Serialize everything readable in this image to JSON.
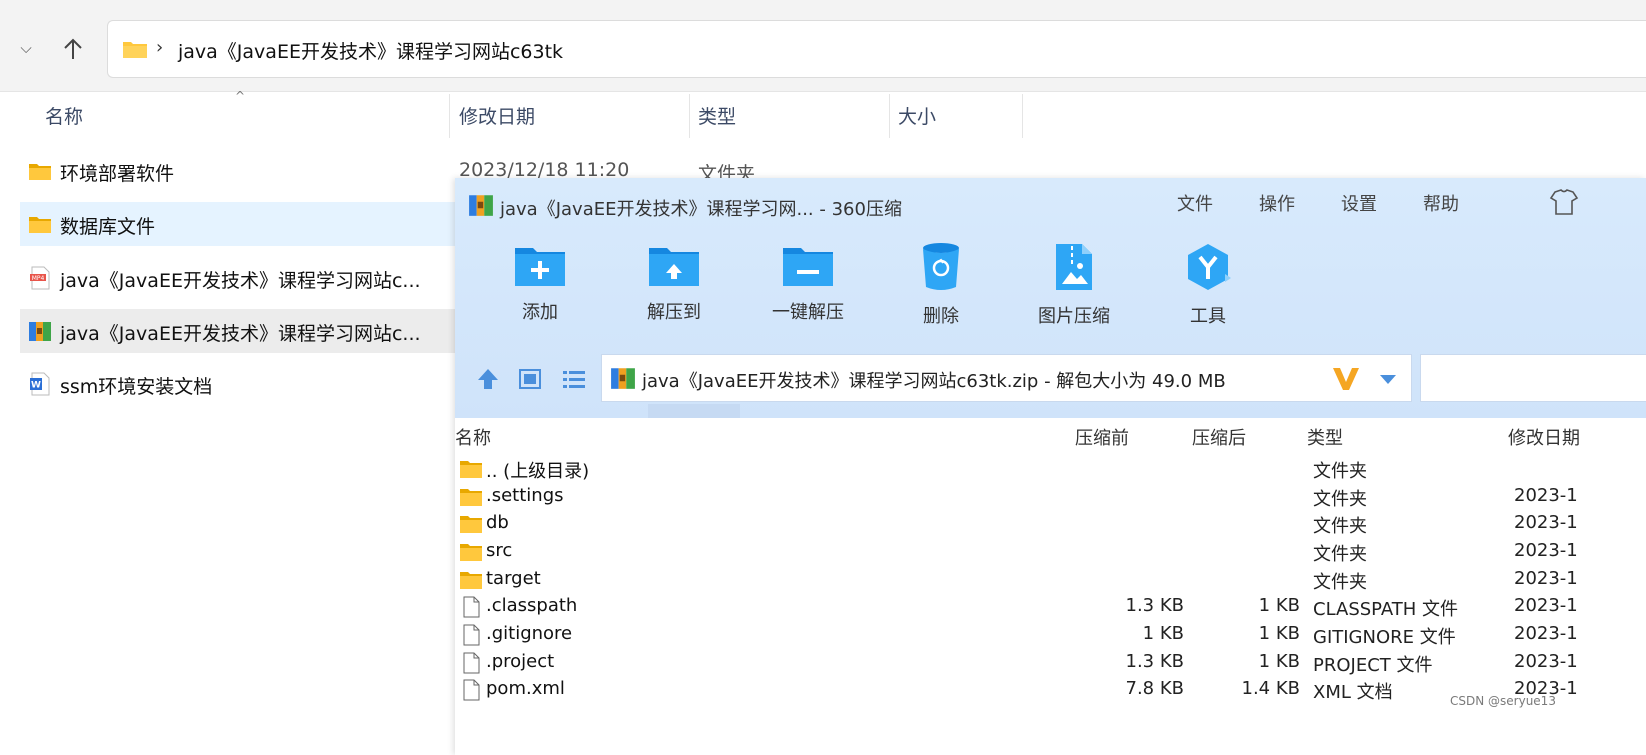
{
  "explorer": {
    "address_path": "java《JavaEE开发技术》课程学习网站c63tk",
    "breadcrumb_sep": "›",
    "columns": {
      "name": "名称",
      "modified": "修改日期",
      "type": "类型",
      "size": "大小"
    },
    "files": [
      {
        "name": "环境部署软件",
        "icon": "folder-icon",
        "modified": "2023/12/18 11:20",
        "type": "文件夹"
      },
      {
        "name": "数据库文件",
        "icon": "folder-icon"
      },
      {
        "name": "java《JavaEE开发技术》课程学习网站c...",
        "icon": "mp4-file-icon"
      },
      {
        "name": "java《JavaEE开发技术》课程学习网站c...",
        "icon": "zip-archive-icon"
      },
      {
        "name": "ssm环境安装文档",
        "icon": "word-document-icon"
      }
    ]
  },
  "zip": {
    "title": "java《JavaEE开发技术》课程学习网... - 360压缩",
    "menu": [
      "文件",
      "操作",
      "设置",
      "帮助"
    ],
    "tools": [
      "添加",
      "解压到",
      "一键解压",
      "删除",
      "图片压缩",
      "工具"
    ],
    "path_text": "java《JavaEE开发技术》课程学习网站c63tk.zip - 解包大小为 49.0 MB",
    "columns": {
      "name": "名称",
      "before": "压缩前",
      "after": "压缩后",
      "type": "类型",
      "modified": "修改日期"
    },
    "rows": [
      {
        "name": ".. (上级目录)",
        "icon": "folder-icon",
        "before": "",
        "after": "",
        "type": "文件夹",
        "modified": ""
      },
      {
        "name": ".settings",
        "icon": "folder-icon",
        "before": "",
        "after": "",
        "type": "文件夹",
        "modified": "2023-1"
      },
      {
        "name": "db",
        "icon": "folder-icon",
        "before": "",
        "after": "",
        "type": "文件夹",
        "modified": "2023-1"
      },
      {
        "name": "src",
        "icon": "folder-icon",
        "before": "",
        "after": "",
        "type": "文件夹",
        "modified": "2023-1"
      },
      {
        "name": "target",
        "icon": "folder-icon",
        "before": "",
        "after": "",
        "type": "文件夹",
        "modified": "2023-1"
      },
      {
        "name": ".classpath",
        "icon": "file-icon",
        "before": "1.3 KB",
        "after": "1 KB",
        "type": "CLASSPATH 文件",
        "modified": "2023-1"
      },
      {
        "name": ".gitignore",
        "icon": "file-icon",
        "before": "1 KB",
        "after": "1 KB",
        "type": "GITIGNORE 文件",
        "modified": "2023-1"
      },
      {
        "name": ".project",
        "icon": "file-icon",
        "before": "1.3 KB",
        "after": "1 KB",
        "type": "PROJECT 文件",
        "modified": "2023-1"
      },
      {
        "name": "pom.xml",
        "icon": "file-icon",
        "before": "7.8 KB",
        "after": "1.4 KB",
        "type": "XML 文档",
        "modified": "2023-1"
      }
    ]
  },
  "watermark": "CSDN @seryue13",
  "colors": {
    "folder": "#ffc83d",
    "zip_header": "#d8eafc",
    "tool_blue": "#1e9af0",
    "hover": "#e5f3ff"
  }
}
